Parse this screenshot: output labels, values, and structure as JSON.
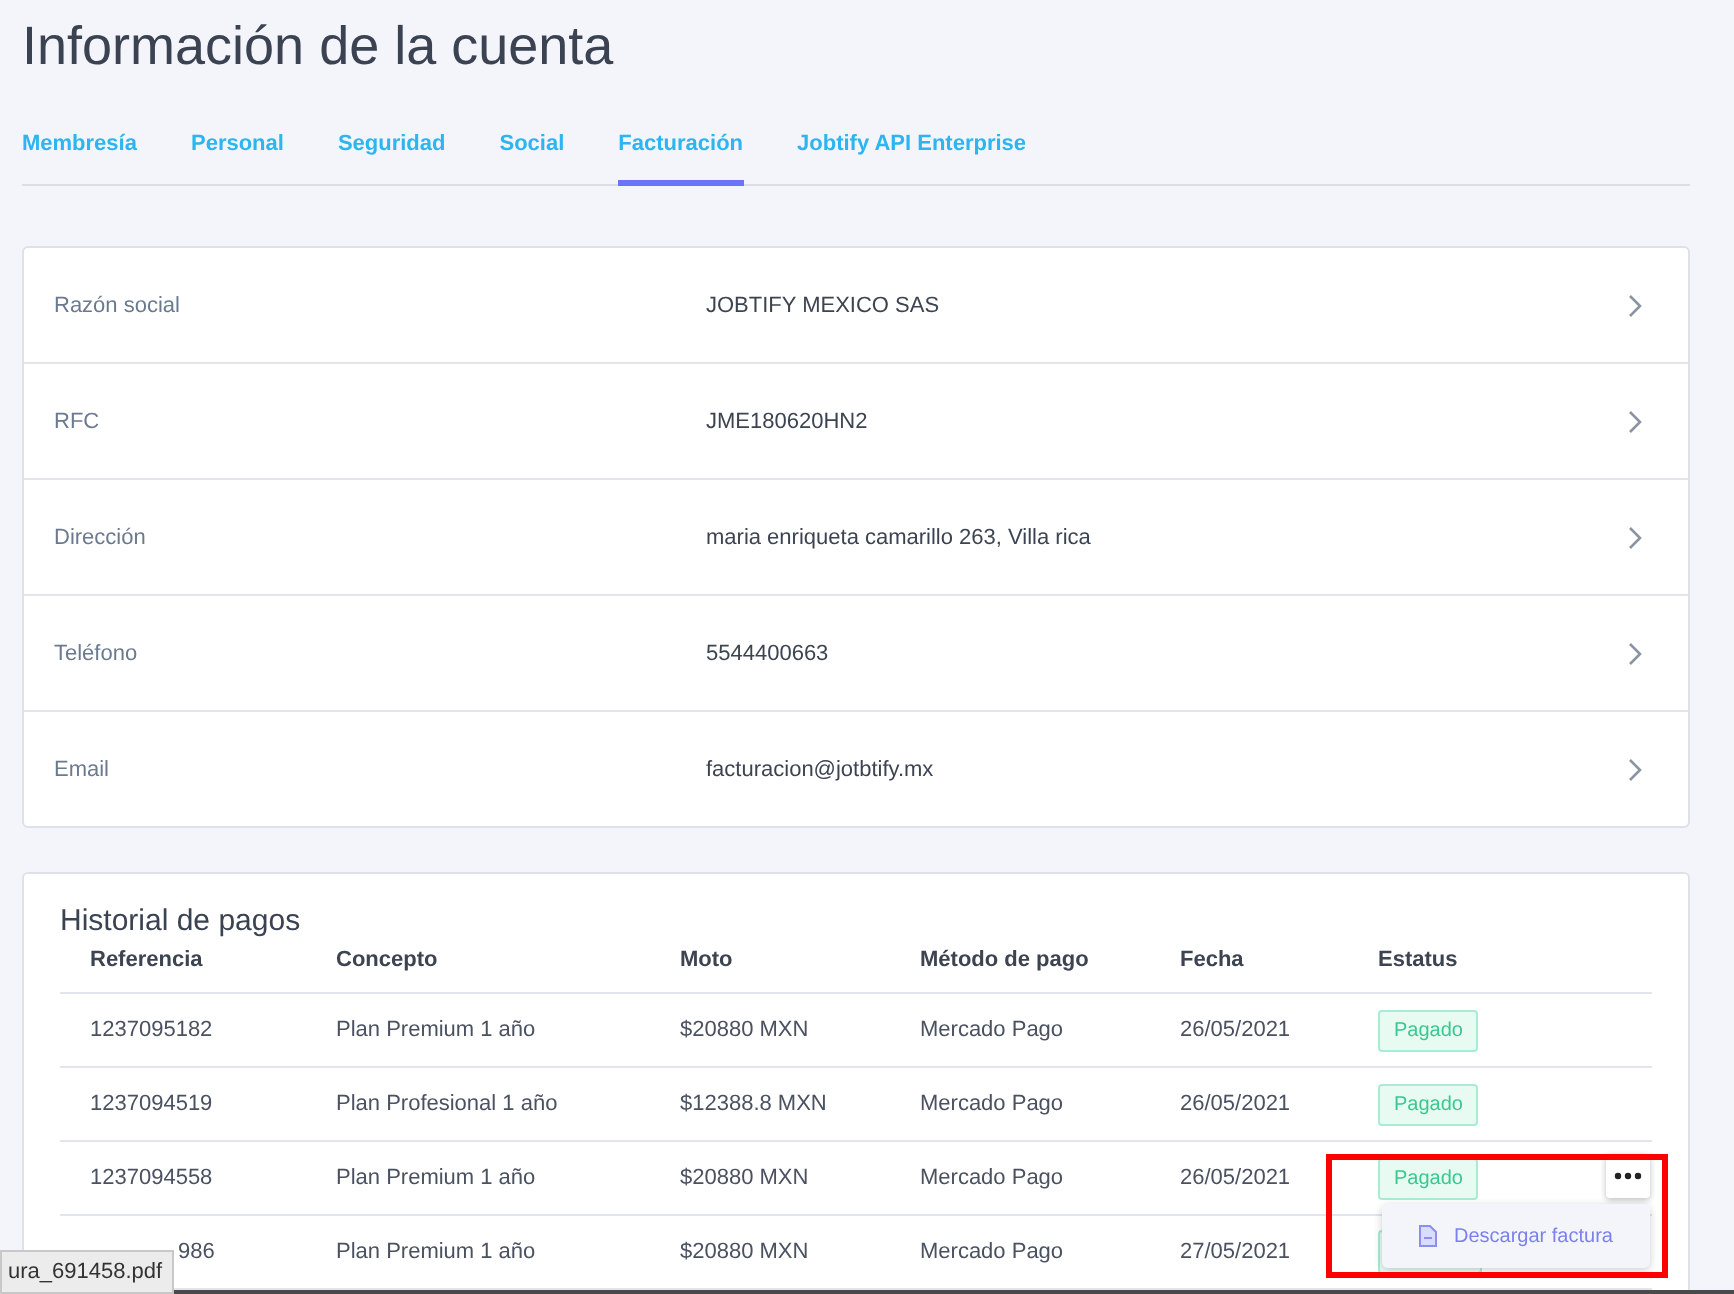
{
  "title": "Información de la cuenta",
  "tabs": [
    {
      "label": "Membresía",
      "selected": false
    },
    {
      "label": "Personal",
      "selected": false
    },
    {
      "label": "Seguridad",
      "selected": false
    },
    {
      "label": "Social",
      "selected": false
    },
    {
      "label": "Facturación",
      "selected": true
    },
    {
      "label": "Jobtify API Enterprise",
      "selected": false
    }
  ],
  "billing_fields": [
    {
      "label": "Razón social",
      "value": "JOBTIFY MEXICO SAS"
    },
    {
      "label": "RFC",
      "value": "JME180620HN2"
    },
    {
      "label": "Dirección",
      "value": "maria enriqueta camarillo 263, Villa rica"
    },
    {
      "label": "Teléfono",
      "value": "5544400663"
    },
    {
      "label": "Email",
      "value": "facturacion@jotbtify.mx"
    }
  ],
  "payments": {
    "title": "Historial de pagos",
    "columns": [
      "Referencia",
      "Concepto",
      "Moto",
      "Método de pago",
      "Fecha",
      "Estatus"
    ],
    "rows": [
      {
        "cells": [
          "1237095182",
          "Plan Premium 1 año",
          "$20880 MXN",
          "Mercado Pago",
          "26/05/2021"
        ],
        "status": "Pagado",
        "menu_open": false
      },
      {
        "cells": [
          "1237094519",
          "Plan Profesional 1 año",
          "$12388.8 MXN",
          "Mercado Pago",
          "26/05/2021"
        ],
        "status": "Pagado",
        "menu_open": false
      },
      {
        "cells": [
          "1237094558",
          "Plan Premium 1 año",
          "$20880 MXN",
          "Mercado Pago",
          "26/05/2021"
        ],
        "status": "Pagado",
        "menu_open": true,
        "menu_items": [
          "Descargar factura"
        ]
      },
      {
        "cells": [
          "986",
          "Plan Premium 1 año",
          "$20880 MXN",
          "Mercado Pago",
          "27/05/2021"
        ],
        "partly_hidden": true,
        "menu_open": false
      }
    ]
  },
  "download_tooltip": "ura_691458.pdf"
}
